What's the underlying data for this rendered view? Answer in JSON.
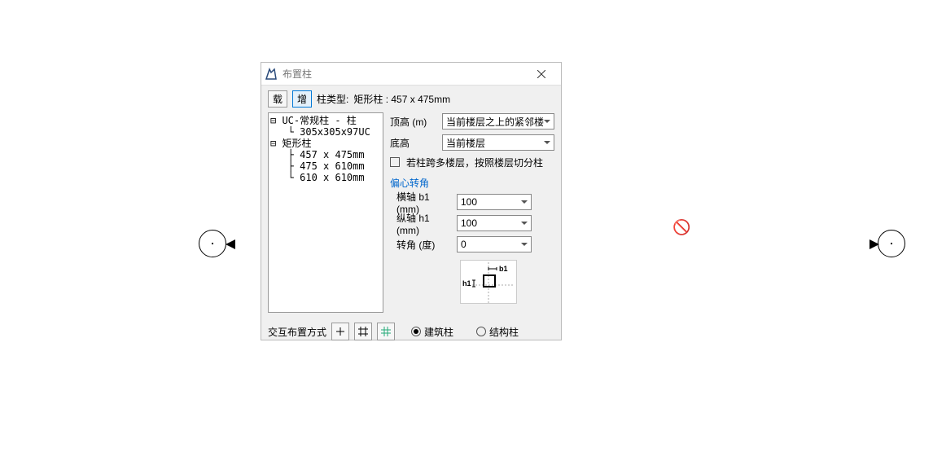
{
  "window": {
    "title": "布置柱"
  },
  "toolbar": {
    "load": "载",
    "add": "增",
    "type_label": "柱类型:",
    "type_value": "矩形柱 : 457 x 475mm"
  },
  "tree": {
    "lines": [
      "⊟ UC-常规柱 - 柱",
      "   └ 305x305x97UC",
      "⊟ 矩形柱",
      "   ├ 457 x 475mm",
      "   ├ 475 x 610mm",
      "   └ 610 x 610mm"
    ]
  },
  "fields": {
    "top_label": "顶高 (m)",
    "top_value": "当前楼层之上的紧邻楼",
    "bottom_label": "底高",
    "bottom_value": "当前楼层",
    "split_checkbox": "若柱跨多楼层，按照楼层切分柱"
  },
  "offset": {
    "section_title": "偏心转角",
    "h_axis_label": "横轴 b1 (mm)",
    "h_axis_value": "100",
    "v_axis_label": "纵轴 h1 (mm)",
    "v_axis_value": "100",
    "angle_label": "转角 (度)",
    "angle_value": "0",
    "diagram_b1": "b1",
    "diagram_h1": "h1"
  },
  "footer": {
    "method_label": "交互布置方式",
    "radio_arch": "建筑柱",
    "radio_struct": "结构柱"
  }
}
